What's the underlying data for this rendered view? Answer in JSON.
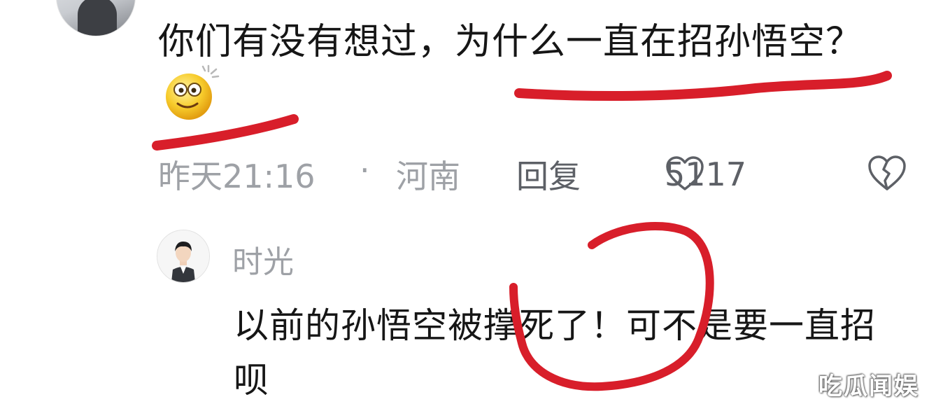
{
  "comment": {
    "text": "你们有没有想过，为什么一直在招孙悟空？",
    "emoji_icon": "dizzy-smile-emoji",
    "time": "昨天21:16",
    "separator": "·",
    "location": "河南",
    "reply_label": "回复",
    "like_count": "5117",
    "like_icon": "heart-outline-icon",
    "dislike_icon": "broken-heart-icon"
  },
  "reply": {
    "avatar_icon": "user-avatar",
    "username": "时光",
    "text": "以前的孙悟空被撑死了！可不是要一直招呗"
  },
  "annotations": {
    "color": "#d81e2a"
  },
  "watermark": {
    "text": "吃瓜闻娱"
  },
  "colors": {
    "text_primary": "#161616",
    "text_secondary": "#9ea1a6",
    "action_text": "#5d6066"
  }
}
